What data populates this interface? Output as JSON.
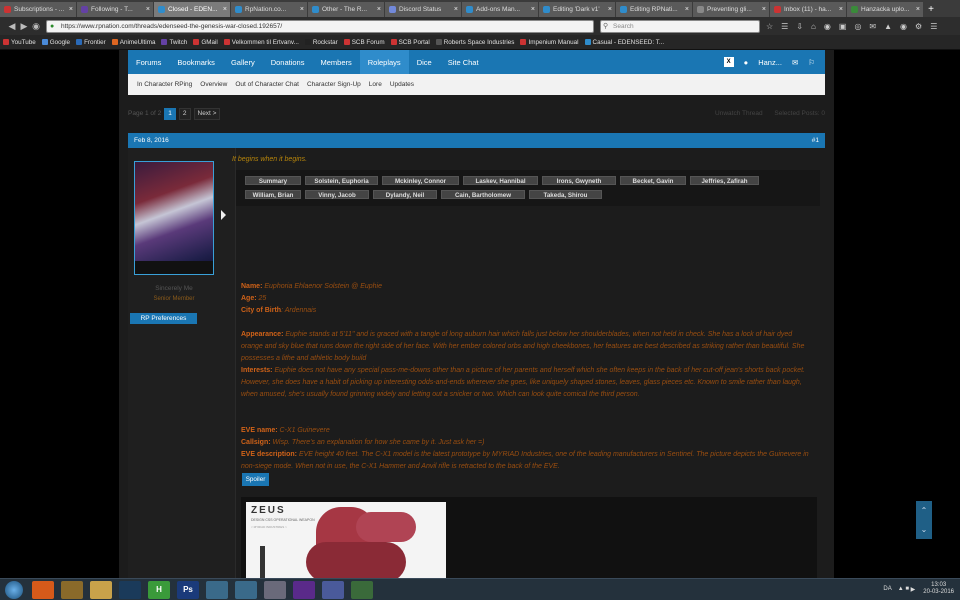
{
  "browser": {
    "tabs": [
      {
        "label": "Subscriptions - ...",
        "color": "#c33"
      },
      {
        "label": "Following - T...",
        "color": "#6441a5"
      },
      {
        "label": "Closed - EDEN...",
        "color": "#2f8ccb"
      },
      {
        "label": "RpNation.co...",
        "color": "#2f8ccb"
      },
      {
        "label": "Other - The R...",
        "color": "#2f8ccb"
      },
      {
        "label": "Discord Status",
        "color": "#7289da"
      },
      {
        "label": "Add-ons Man...",
        "color": "#2f8ccb"
      },
      {
        "label": "Editing 'Dark v1'",
        "color": "#2f8ccb"
      },
      {
        "label": "Editing RPNati...",
        "color": "#2f8ccb"
      },
      {
        "label": "Preventing gli...",
        "color": "#888"
      },
      {
        "label": "Inbox (11) - ha...",
        "color": "#c33"
      },
      {
        "label": "Hanzacka uplo...",
        "color": "#3a8a3a"
      }
    ],
    "new_tab": "+",
    "active_tab_index": 2,
    "address": "https://www.rpnation.com/threads/edenseed-the-genesis-war-closed.192657/",
    "search_placeholder": "Search",
    "bookmarks": [
      "YouTube",
      "Google",
      "Frontier",
      "AnimeUltima",
      "Twitch",
      "GMail",
      "Velkommen til Ertvanv...",
      "Rockstar",
      "SCB Forum",
      "SCB Portal",
      "Roberts Space Industries",
      "Impenium Manual",
      "Casual - EDENSEED: T..."
    ]
  },
  "site": {
    "nav": [
      "Forums",
      "Bookmarks",
      "Gallery",
      "Donations",
      "Members",
      "Roleplays",
      "Dice",
      "Site Chat"
    ],
    "nav_selected": "Roleplays",
    "user": "Hanz...",
    "subnav": [
      "In Character RPing",
      "Overview",
      "Out of Character Chat",
      "Character Sign-Up",
      "Lore",
      "Updates"
    ],
    "pagination": {
      "label": "Page 1 of 2",
      "pages": [
        "1",
        "2"
      ],
      "next": "Next >",
      "unwatch": "Unwatch Thread",
      "selected_posts": "Selected Posts: 0"
    },
    "post": {
      "date": "Feb 8, 2016",
      "number": "#1",
      "author": "Sincerely Me",
      "author_title": "Senior Member",
      "rp_button": "RP Preferences",
      "quote": "It begins when it begins.",
      "tabs_row1": [
        "Summary",
        "Solstein, Euphoria",
        "Mckinley, Connor",
        "Laskev, Hannibal",
        "Irons, Gwyneth",
        "Becket, Gavin",
        "Jeffries, Zafirah"
      ],
      "tabs_row2": [
        "William, Brian",
        "Vinny, Jacob",
        "Dylandy, Neil",
        "Cain, Bartholomew",
        "Takeda, Shirou"
      ],
      "name_label": "Name:",
      "name_value": "Euphoria Ehlaenor Solstein @ Euphie",
      "age_label": "Age:",
      "age_value": "25",
      "cob_label": "City of Birth",
      "cob_value": ": Ardennais",
      "appearance_label": "Appearance:",
      "appearance_text": "Euphie stands at 5'11\" and is graced with a tangle of long auburn hair which falls just below her shoulderblades, when not held in check. She has a lock of hair dyed orange and sky blue that runs down the right side of her face. With her ember colored orbs and high cheekbones, her features are best described as striking rather than beautiful. She possesses a lithe and athletic body build",
      "interests_label": "Interests:",
      "interests_text": "Euphie does not have any special pass-me-downs other than a picture of her parents and herself which she often keeps in the back of her cut-off jean's shorts back pocket. However, she does have a habit of picking up interesting odds-and-ends wherever she goes, like uniquely shaped stones, leaves, glass pieces etc. Known to smile rather than laugh, when amused, she's usually found grinning widely and letting out a snicker or two. Which can look quite comical the third person.",
      "eve_name_label": "EVE name:",
      "eve_name_value": "C-X1 Guinevere",
      "callsign_label": "Callsign:",
      "callsign_value": "Wisp. There's an explanation for how she came by it. Just ask her =)",
      "eve_desc_label": "EVE description:",
      "eve_desc_text": "EVE height 40 feet. The C-X1 model is the latest prototype by MYRIAD Industries, one of the leading manufacturers in Sentinel. The picture depicts the Guinevere in non-siege mode. When not in use, the C-X1 Hammer and Anvil rifle is retracted to the back of the EVE.",
      "spoiler": "Spoiler",
      "image_title": "ZEUS",
      "image_subtitle": "DESIGN CSS OPERATIONAL WEAPON",
      "image_spec": "< MYRIAD INDUSTRIES >"
    }
  },
  "taskbar": {
    "apps": [
      {
        "name": "firefox",
        "color": "#d65a1a",
        "glyph": ""
      },
      {
        "name": "tools",
        "color": "#8a6a2a",
        "glyph": ""
      },
      {
        "name": "explorer",
        "color": "#c9a24a",
        "glyph": ""
      },
      {
        "name": "steam",
        "color": "#1a3a5a",
        "glyph": ""
      },
      {
        "name": "hexchat",
        "color": "#3a9a3a",
        "glyph": "H"
      },
      {
        "name": "photoshop",
        "color": "#1a3a7a",
        "glyph": "Ps"
      },
      {
        "name": "app7",
        "color": "#3a6a8a",
        "glyph": ""
      },
      {
        "name": "app8",
        "color": "#3a6a8a",
        "glyph": ""
      },
      {
        "name": "app9",
        "color": "#6a6a7a",
        "glyph": ""
      },
      {
        "name": "visual-studio",
        "color": "#5a2a8a",
        "glyph": ""
      },
      {
        "name": "discord",
        "color": "#4a5a9a",
        "glyph": ""
      },
      {
        "name": "app12",
        "color": "#3a6a3a",
        "glyph": ""
      }
    ],
    "lang": "DA",
    "time": "13:03",
    "date": "20-03-2016"
  }
}
